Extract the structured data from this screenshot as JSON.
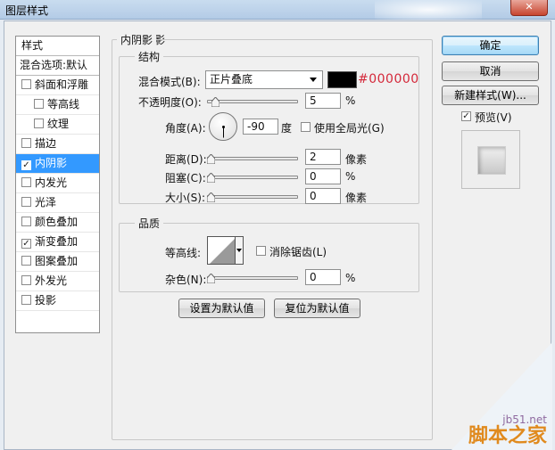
{
  "window": {
    "title": "图层样式",
    "close_glyph": "✕"
  },
  "styles_panel": {
    "header": "样式",
    "blend_options": "混合选项:默认",
    "items": [
      {
        "label": "斜面和浮雕",
        "checked": false,
        "sub": false,
        "selected": false
      },
      {
        "label": "等高线",
        "checked": false,
        "sub": true,
        "selected": false
      },
      {
        "label": "纹理",
        "checked": false,
        "sub": true,
        "selected": false
      },
      {
        "label": "描边",
        "checked": false,
        "sub": false,
        "selected": false
      },
      {
        "label": "内阴影",
        "checked": true,
        "sub": false,
        "selected": true
      },
      {
        "label": "内发光",
        "checked": false,
        "sub": false,
        "selected": false
      },
      {
        "label": "光泽",
        "checked": false,
        "sub": false,
        "selected": false
      },
      {
        "label": "颜色叠加",
        "checked": false,
        "sub": false,
        "selected": false
      },
      {
        "label": "渐变叠加",
        "checked": true,
        "sub": false,
        "selected": false
      },
      {
        "label": "图案叠加",
        "checked": false,
        "sub": false,
        "selected": false
      },
      {
        "label": "外发光",
        "checked": false,
        "sub": false,
        "selected": false
      },
      {
        "label": "投影",
        "checked": false,
        "sub": false,
        "selected": false
      }
    ]
  },
  "inner_shadow": {
    "section_title": "内阴影",
    "structure": {
      "title": "结构",
      "blend_mode_label": "混合模式(B):",
      "blend_mode_value": "正片叠底",
      "color_hex": "#000000",
      "color_value": "#000000",
      "opacity_label": "不透明度(O):",
      "opacity_value": "5",
      "opacity_unit": "%",
      "opacity_level": 0.05,
      "angle_label": "角度(A):",
      "angle_value": "-90",
      "angle_unit": "度",
      "global_light_label": "使用全局光(G)",
      "global_light_checked": false,
      "distance_label": "距离(D):",
      "distance_value": "2",
      "distance_unit": "像素",
      "distance_level": 0.0,
      "choke_label": "阻塞(C):",
      "choke_value": "0",
      "choke_unit": "%",
      "choke_level": 0.0,
      "size_label": "大小(S):",
      "size_value": "0",
      "size_unit": "像素",
      "size_level": 0.0
    },
    "quality": {
      "title": "品质",
      "contour_label": "等高线:",
      "anti_alias_label": "消除锯齿(L)",
      "anti_alias_checked": false,
      "noise_label": "杂色(N):",
      "noise_value": "0",
      "noise_unit": "%",
      "noise_level": 0.0
    },
    "make_default_button": "设置为默认值",
    "reset_default_button": "复位为默认值"
  },
  "actions": {
    "ok": "确定",
    "cancel": "取消",
    "new_style": "新建样式(W)...",
    "preview_label": "预览(V)",
    "preview_checked": true
  },
  "watermark": {
    "site": "jb51.net",
    "brand": "脚本之家"
  },
  "colors": {
    "selection": "#3399ff",
    "hex_text": "#d4283a"
  }
}
